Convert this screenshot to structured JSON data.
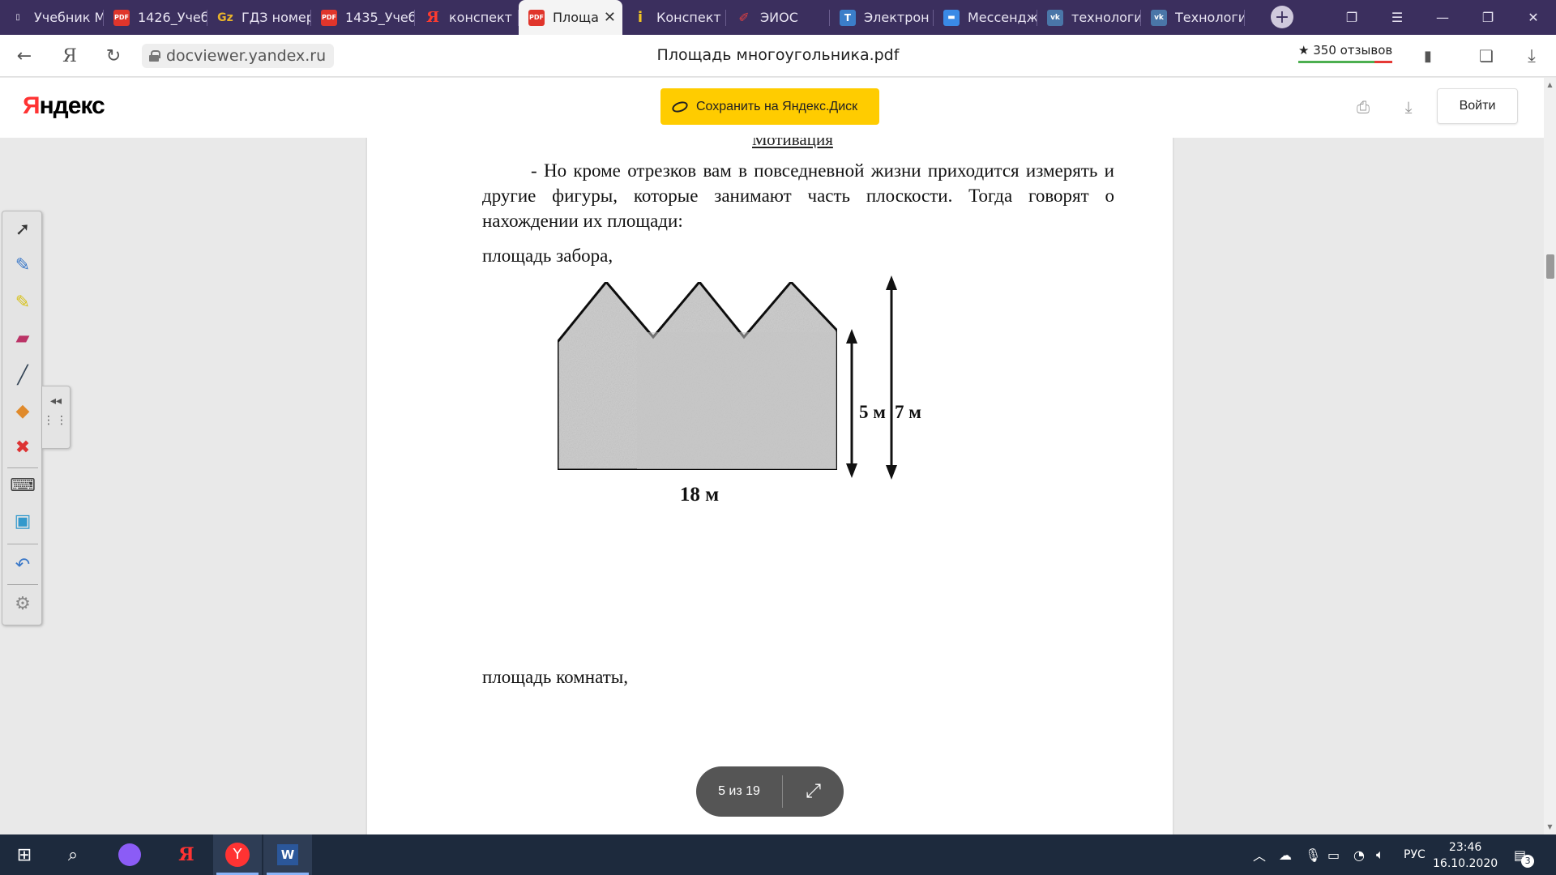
{
  "tabs": [
    {
      "label": "Учебник М",
      "favicon": "doc-icon",
      "active": false
    },
    {
      "label": "1426_Учеб",
      "favicon": "pdf-icon",
      "active": false
    },
    {
      "label": "ГДЗ номер",
      "favicon": "gdz-icon",
      "active": false
    },
    {
      "label": "1435_Учеб",
      "favicon": "pdf-icon",
      "active": false
    },
    {
      "label": "конспект",
      "favicon": "yandex-icon",
      "active": false
    },
    {
      "label": "Площа",
      "favicon": "pdf-icon",
      "active": true
    },
    {
      "label": "Конспект",
      "favicon": "info-icon",
      "active": false
    },
    {
      "label": "ЭИОС",
      "favicon": "eios-icon",
      "active": false
    },
    {
      "label": "Электрон",
      "favicon": "electron-icon",
      "active": false
    },
    {
      "label": "Мессендж",
      "favicon": "messenger-icon",
      "active": false
    },
    {
      "label": "технологи",
      "favicon": "vk-icon",
      "active": false
    },
    {
      "label": "Технологи",
      "favicon": "vk-icon",
      "active": false
    }
  ],
  "address_bar": {
    "url": "docviewer.yandex.ru",
    "title": "Площадь многоугольника.pdf",
    "reviews": "350 отзывов"
  },
  "header": {
    "logo_first": "Я",
    "logo_rest": "ндекс",
    "save_button": "Сохранить на Яндекс.Диск",
    "login_button": "Войти"
  },
  "document": {
    "heading": "Мотивация",
    "paragraph": "- Но кроме отрезков вам в повседневной жизни приходится измерять и другие фигуры, которые занимают часть плоскости. Тогда говорят о нахождении их площади:",
    "line1": "площадь забора,",
    "line2": "площадь комнаты,",
    "figure": {
      "height_small": "5 м",
      "height_large": "7 м",
      "width": "18 м"
    }
  },
  "pager": {
    "label": "5 из 19"
  },
  "taskbar": {
    "language": "РУС",
    "time": "23:46",
    "date": "16.10.2020",
    "notifications": "3"
  }
}
